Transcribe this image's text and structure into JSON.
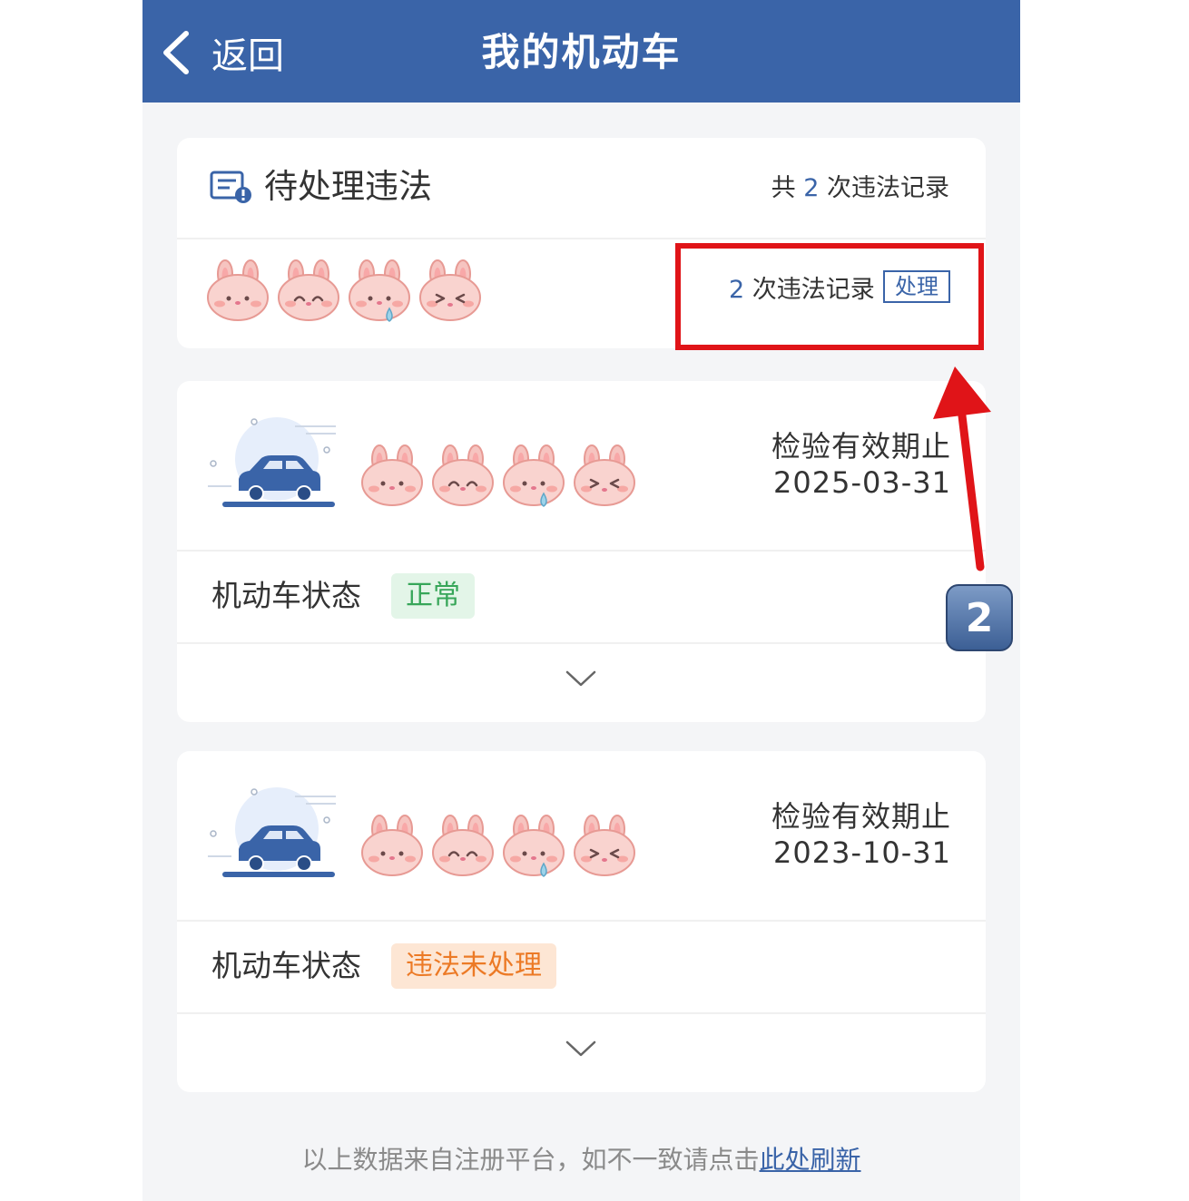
{
  "nav": {
    "back_label": "返回",
    "title": "我的机动车"
  },
  "pending": {
    "title": "待处理违法",
    "total_prefix": "共",
    "total_count": "2",
    "total_suffix": "次违法记录",
    "record_count": "2",
    "record_text": "次违法记录",
    "process_label": "处理"
  },
  "vehicles": [
    {
      "expiry_label": "检验有效期止",
      "expiry_date": "2025-03-31",
      "status_label": "机动车状态",
      "status": "正常",
      "status_color": "#37a659"
    },
    {
      "expiry_label": "检验有效期止",
      "expiry_date": "2023-10-31",
      "status_label": "机动车状态",
      "status": "违法未处理",
      "status_color": "#ec7a26"
    }
  ],
  "footer": {
    "note": "以上数据来自注册平台，如不一致请点击",
    "refresh_link": "此处刷新"
  },
  "annotation": {
    "step_number": "2",
    "arrow_color": "#e01418"
  },
  "colors": {
    "nav_bg": "#3a64a8",
    "accent": "#3a64a8"
  }
}
